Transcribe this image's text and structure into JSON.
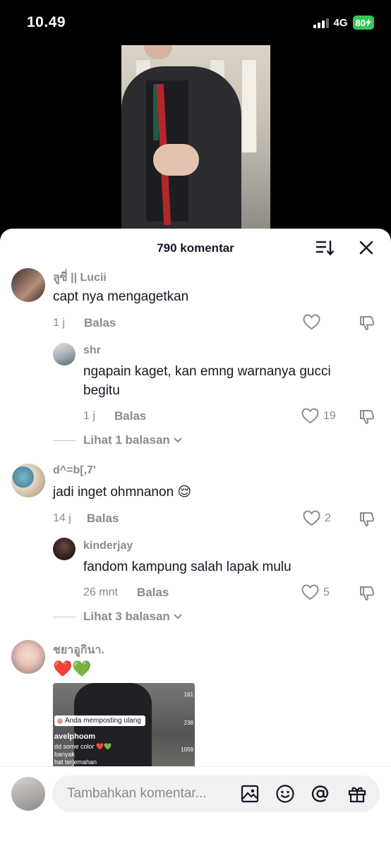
{
  "status_bar": {
    "time": "10.49",
    "network": "4G",
    "battery": "80"
  },
  "header": {
    "title": "790 komentar"
  },
  "comments": [
    {
      "username": "ลูซี่ || Lucii",
      "text": "capt nya mengagetkan",
      "time": "1 j",
      "reply_label": "Balas",
      "likes": ""
    },
    {
      "username": "shr",
      "text_line1": "ngapain kaget, kan emng warnanya gucci",
      "text_line2": "begitu",
      "time": "1 j",
      "reply_label": "Balas",
      "likes": "19"
    },
    {
      "username": "d^=b[,7'",
      "text": "jadi inget ohmnanon 😌",
      "time": "14 j",
      "reply_label": "Balas",
      "likes": "2"
    },
    {
      "username": "kinderjay",
      "text": "fandom kampung salah lapak mulu",
      "time": "26 mnt",
      "reply_label": "Balas",
      "likes": "5"
    },
    {
      "username": "ชยาอูกินา.",
      "text": "❤️💚"
    }
  ],
  "more_replies": [
    "Lihat 1 balasan",
    "Lihat 3 balasan"
  ],
  "thumbnail": {
    "repost_label": "Anda memposting ulang",
    "username": "avelphoom",
    "caption_line1": "dd some color ❤️💚",
    "caption_line2": "banyak",
    "caption_line3": "hat terjemahan",
    "side_1": "161",
    "side_2": "238",
    "side_3": "1059"
  },
  "input": {
    "placeholder": "Tambahkan komentar..."
  },
  "colors": {
    "primary_text": "#161823",
    "secondary_text": "#8a8b91",
    "battery_green": "#34c759",
    "input_bg": "#f1f1f2"
  },
  "icons": [
    "sort-icon",
    "close-icon",
    "heart-icon",
    "dislike-icon",
    "chevron-down-icon",
    "image-icon",
    "emoji-icon",
    "at-icon",
    "gift-icon"
  ]
}
